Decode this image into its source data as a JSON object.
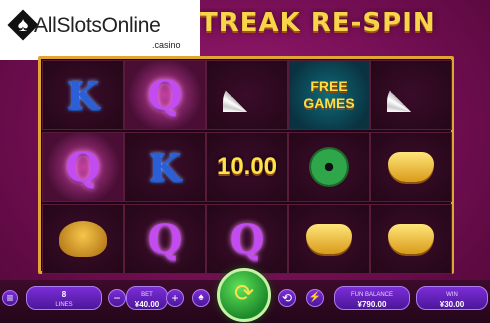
{
  "logo": {
    "main": "AllSlotsOnline",
    "sub": ".casino",
    "spade": "♠"
  },
  "title": "TREAK RE-SPIN",
  "reels": [
    [
      {
        "kind": "k",
        "text": "K"
      },
      {
        "kind": "q-glow",
        "text": "Q"
      },
      {
        "kind": "fan",
        "text": ""
      },
      {
        "kind": "free",
        "text": "FREE GAMES"
      },
      {
        "kind": "fan",
        "text": ""
      }
    ],
    [
      {
        "kind": "q-glow",
        "text": "Q"
      },
      {
        "kind": "k",
        "text": "K"
      },
      {
        "kind": "value",
        "text": "10.00"
      },
      {
        "kind": "coin",
        "text": ""
      },
      {
        "kind": "ingot",
        "text": ""
      }
    ],
    [
      {
        "kind": "turtle",
        "text": ""
      },
      {
        "kind": "q",
        "text": "Q"
      },
      {
        "kind": "q",
        "text": "Q"
      },
      {
        "kind": "ingot",
        "text": ""
      },
      {
        "kind": "ingot",
        "text": ""
      }
    ]
  ],
  "controls": {
    "lines_value": "8",
    "lines_label": "LINES",
    "bet_label": "BET",
    "bet_value": "¥40.00",
    "balance_label": "FUN BALANCE",
    "balance_value": "¥790.00",
    "win_label": "WIN",
    "win_value": "¥30.00",
    "menu_icon": "≡",
    "minus": "−",
    "plus": "+",
    "spin_icon": "⟳",
    "autoplay_icon": "⟲",
    "turbo_icon": "⚡",
    "info_icon": "♠"
  },
  "colors": {
    "frame": "#e0a634",
    "background": "#7a1058",
    "button": "#7c2dd8",
    "spin": "#2fa64a"
  }
}
